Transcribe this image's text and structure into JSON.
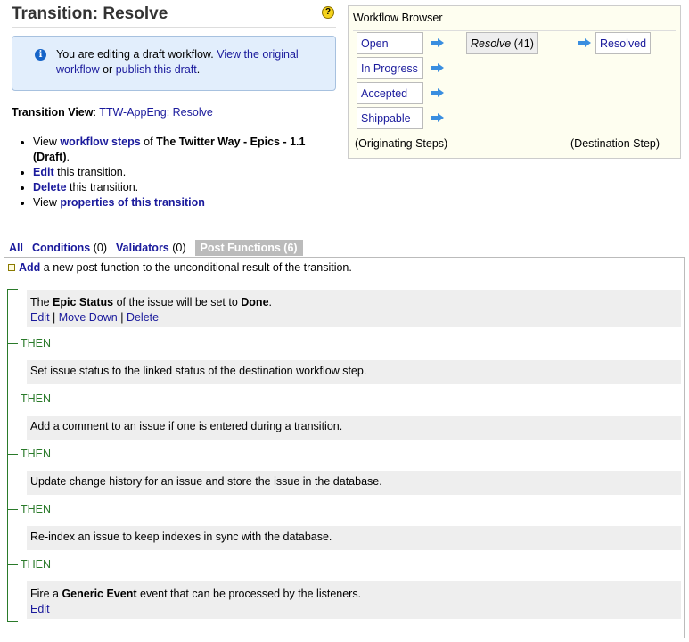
{
  "page": {
    "title": "Transition: Resolve",
    "help_icon": "?"
  },
  "info": {
    "text1": "You are editing a draft workflow.",
    "link1": "View the original workflow",
    "text2": "or",
    "link2": "publish this draft",
    "text3": "."
  },
  "transition_view": {
    "label": "Transition View",
    "value": "TTW-AppEng: Resolve"
  },
  "actions": {
    "a1_pre": "View",
    "a1_link": "workflow steps",
    "a1_mid": "of",
    "a1_bold": "The Twitter Way - Epics - 1.1 (Draft)",
    "a1_end": ".",
    "a2_link": "Edit",
    "a2_rest": "this transition.",
    "a3_link": "Delete",
    "a3_rest": "this transition.",
    "a4_pre": "View",
    "a4_link": "properties of this transition"
  },
  "workflow_browser": {
    "title": "Workflow Browser",
    "origin_steps": [
      "Open",
      "In Progress",
      "Accepted",
      "Shippable"
    ],
    "current": "Resolve",
    "current_count": "(41)",
    "destination": "Resolved",
    "origin_label": "(Originating Steps)",
    "dest_label": "(Destination Step)"
  },
  "tabs": [
    {
      "label": "All"
    },
    {
      "label": "Conditions",
      "count": "(0)"
    },
    {
      "label": "Validators",
      "count": "(0)"
    },
    {
      "label": "Post Functions",
      "count": "(6)"
    }
  ],
  "add": {
    "link": "Add",
    "rest": "a new post function to the unconditional result of the transition."
  },
  "then_label": "THEN",
  "post_functions": {
    "f1": {
      "pre": "The",
      "b1": "Epic Status",
      "mid": "of the issue will be set to",
      "b2": "Done",
      "end": ".",
      "edit": "Edit",
      "move": "Move Down",
      "del": "Delete"
    },
    "f2": "Set issue status to the linked status of the destination workflow step.",
    "f3": "Add a comment to an issue if one is entered during a transition.",
    "f4": "Update change history for an issue and store the issue in the database.",
    "f5": "Re-index an issue to keep indexes in sync with the database.",
    "f6": {
      "pre": "Fire a",
      "b": "Generic Event",
      "rest": "event that can be processed by the listeners.",
      "edit": "Edit"
    }
  }
}
